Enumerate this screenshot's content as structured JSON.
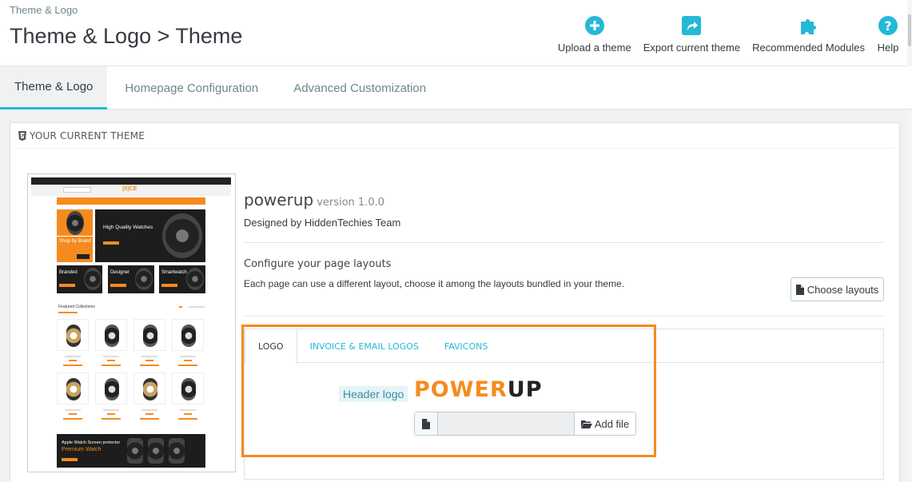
{
  "header": {
    "breadcrumb": "Theme & Logo",
    "title": "Theme & Logo > Theme",
    "toolbar": [
      {
        "label": "Upload a theme",
        "icon": "plus-circle-icon"
      },
      {
        "label": "Export current theme",
        "icon": "export-icon"
      },
      {
        "label": "Recommended Modules",
        "icon": "puzzle-icon"
      },
      {
        "label": "Help",
        "icon": "help-icon"
      }
    ]
  },
  "tabs": [
    {
      "label": "Theme & Logo",
      "active": true
    },
    {
      "label": "Homepage Configuration",
      "active": false
    },
    {
      "label": "Advanced Customization",
      "active": false
    }
  ],
  "panel": {
    "heading": "YOUR CURRENT THEME",
    "theme": {
      "name": "powerup",
      "version": "version 1.0.0",
      "author": "Designed by HiddenTechies Team"
    },
    "layouts": {
      "title": "Configure your page layouts",
      "description": "Each page can use a different layout, choose it among the layouts bundled in your theme.",
      "button": "Choose layouts"
    },
    "logo_tabs": [
      {
        "label": "LOGO",
        "active": true
      },
      {
        "label": "INVOICE & EMAIL LOGOS",
        "active": false
      },
      {
        "label": "FAVICONS",
        "active": false
      }
    ],
    "header_logo_label": "Header logo",
    "logo_text": {
      "part1": "P",
      "o": "O",
      "part2": "WER",
      "part3": "UP"
    },
    "add_file": "Add file"
  },
  "preview": {
    "hero_text": "High Quality Watches",
    "shop_by_brand": "Shop by Brand",
    "cards": [
      "Branded",
      "Designer",
      "Smartwatch"
    ],
    "featured": "Featured Collections",
    "banner_line1": "Apple Watch Screen protector",
    "banner_line2": "Premium Watch"
  },
  "colors": {
    "accent": "#25b9d7",
    "brand_orange": "#f58b1e",
    "text": "#363a41"
  }
}
